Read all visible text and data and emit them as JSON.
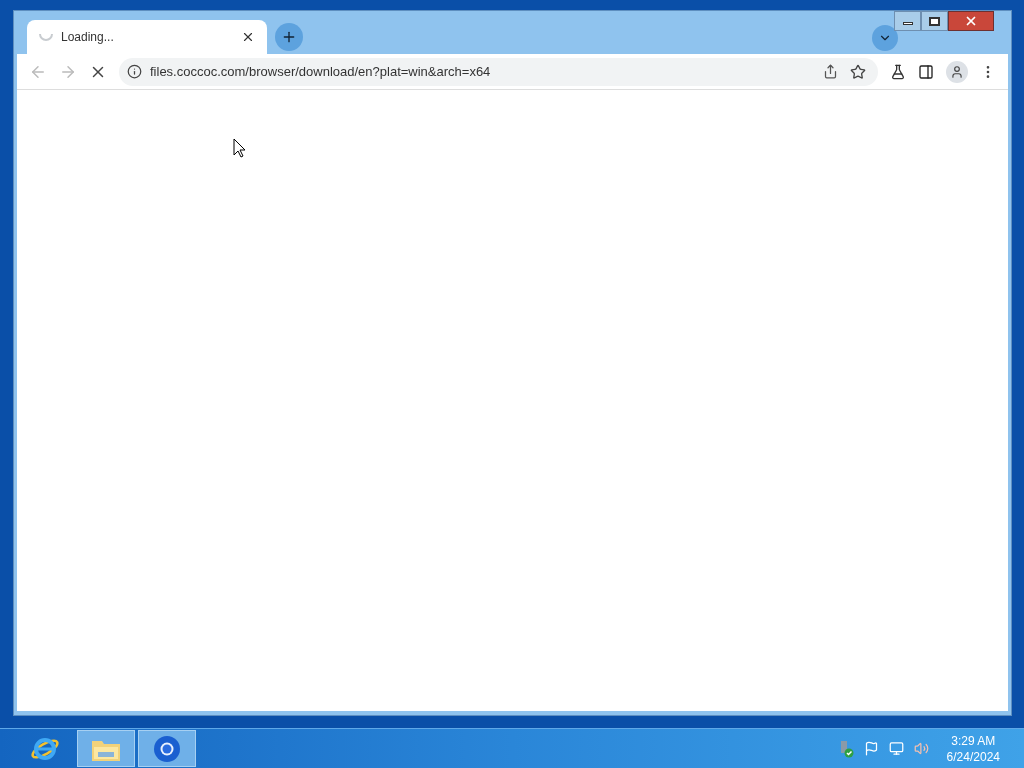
{
  "browser": {
    "tabs": [
      {
        "title": "Loading...",
        "loading": true,
        "selected": true
      }
    ],
    "address": "files.coccoc.com/browser/download/en?plat=win&arch=x64",
    "loading": true
  },
  "taskbar": {
    "apps": [
      {
        "kind": "ie",
        "running": false
      },
      {
        "kind": "explorer",
        "running": true
      },
      {
        "kind": "chrome",
        "running": true
      }
    ],
    "time": "3:29 AM",
    "date": "6/24/2024"
  }
}
